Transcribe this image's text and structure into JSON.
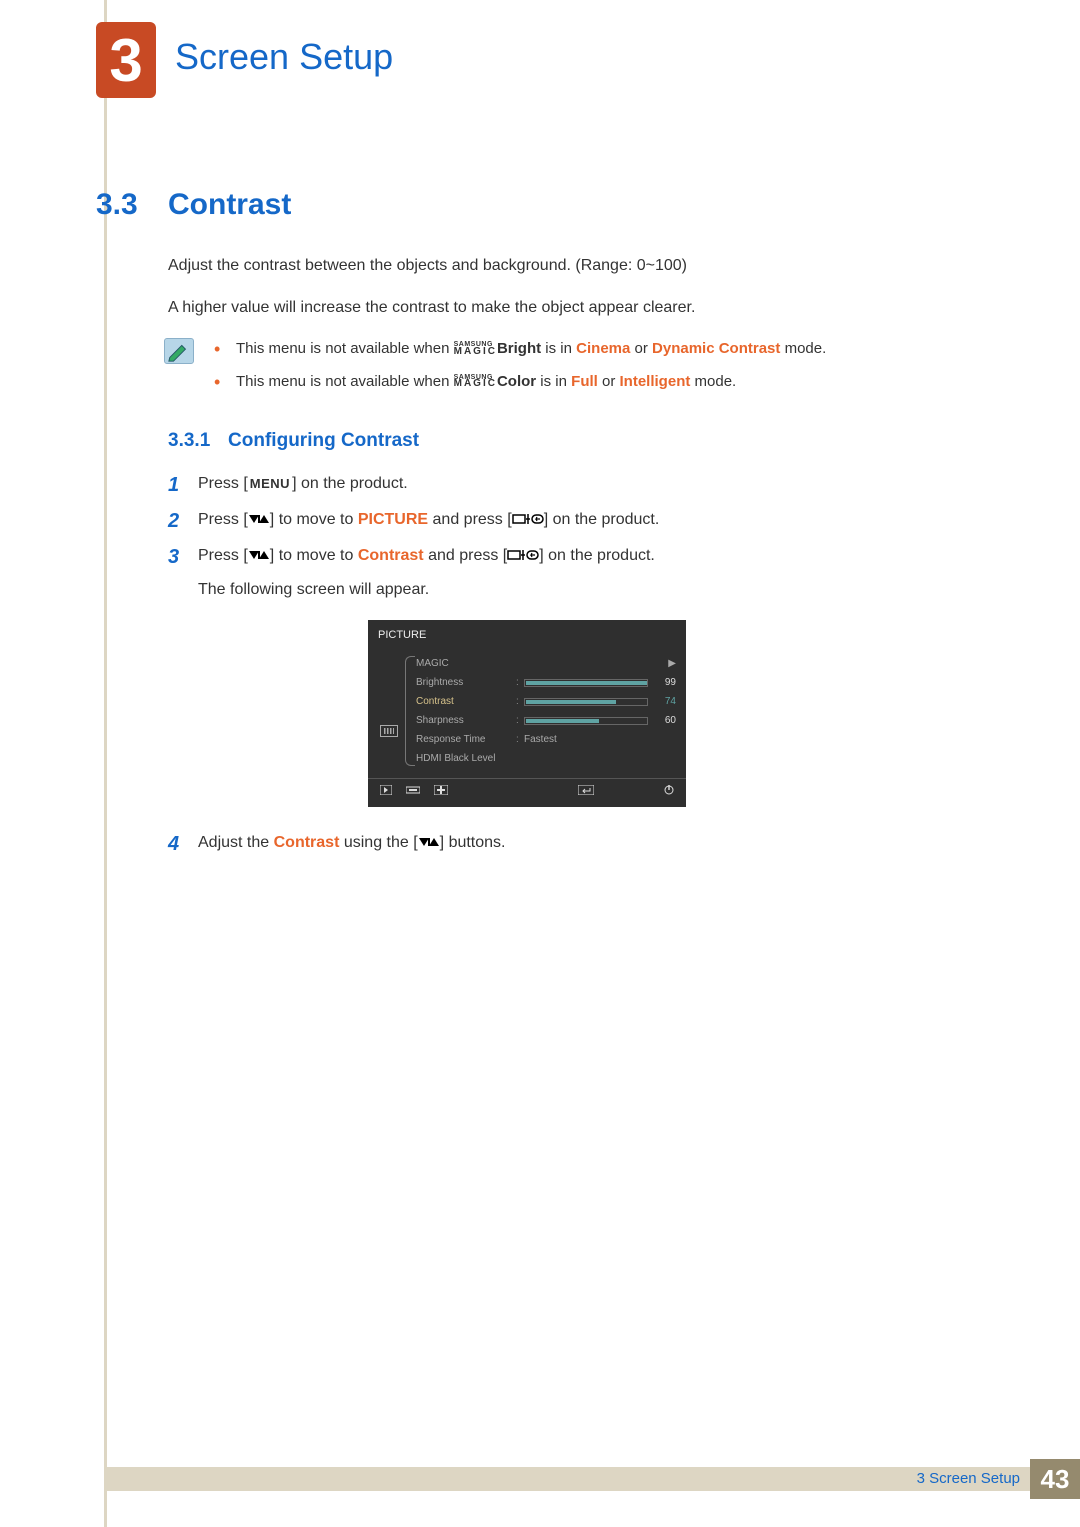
{
  "chapter": {
    "number": "3",
    "title": "Screen Setup"
  },
  "section": {
    "number": "3.3",
    "title": "Contrast"
  },
  "intro": {
    "p1": "Adjust the contrast between the objects and background. (Range: 0~100)",
    "p2": "A higher value will increase the contrast to make the object appear clearer."
  },
  "magic": {
    "top": "SAMSUNG",
    "bottom": "MAGIC"
  },
  "notes": {
    "item1": {
      "pre": "This menu is not available when ",
      "suffix": "Bright",
      "mid": " is in ",
      "k1": "Cinema",
      "or": " or ",
      "k2": "Dynamic Contrast",
      "post": " mode."
    },
    "item2": {
      "pre": "This menu is not available when ",
      "suffix": "Color",
      "mid": " is in ",
      "k1": "Full",
      "or": " or ",
      "k2": "Intelligent",
      "post": " mode."
    }
  },
  "subsection": {
    "number": "3.3.1",
    "title": "Configuring Contrast"
  },
  "steps": {
    "s1": {
      "num": "1",
      "a": "Press [",
      "menu": "MENU",
      "b": "] on the product."
    },
    "s2": {
      "num": "2",
      "a": "Press [",
      "b": "] to move to ",
      "kw": "PICTURE",
      "c": " and press [",
      "d": "] on the product."
    },
    "s3": {
      "num": "3",
      "a": "Press [",
      "b": "] to move to ",
      "kw": "Contrast",
      "c": " and press [",
      "d": "] on the product.",
      "note": "The following screen will appear."
    },
    "s4": {
      "num": "4",
      "a": "Adjust the ",
      "kw": "Contrast",
      "b": " using the [",
      "c": "] buttons."
    }
  },
  "osd": {
    "title": "PICTURE",
    "rows": {
      "magic": "MAGIC",
      "brightness": {
        "label": "Brightness",
        "value": "99",
        "pct": 99
      },
      "contrast": {
        "label": "Contrast",
        "value": "74",
        "pct": 74
      },
      "sharpness": {
        "label": "Sharpness",
        "value": "60",
        "pct": 60
      },
      "response": {
        "label": "Response Time",
        "value": "Fastest"
      },
      "hdmi": {
        "label": "HDMI Black Level"
      }
    }
  },
  "footer": {
    "label": "3 Screen Setup",
    "page": "43"
  }
}
